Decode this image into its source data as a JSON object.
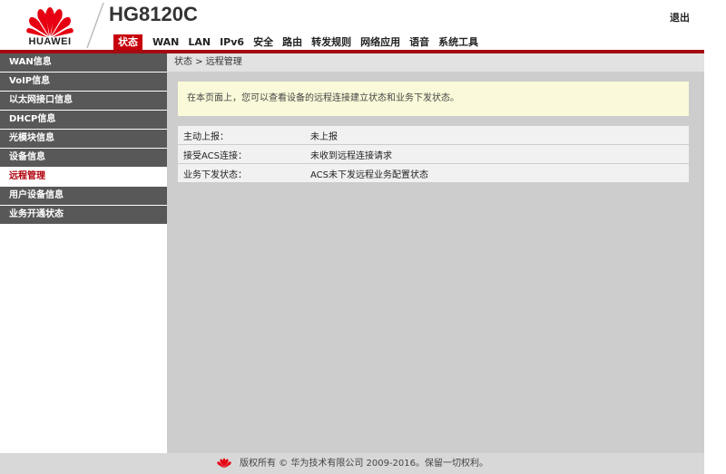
{
  "header": {
    "brand": "HUAWEI",
    "model": "HG8120C",
    "logout": "退出"
  },
  "nav": [
    "状态",
    "WAN",
    "LAN",
    "IPv6",
    "安全",
    "路由",
    "转发规则",
    "网络应用",
    "语音",
    "系统工具"
  ],
  "nav_active": 0,
  "sidebar": [
    "WAN信息",
    "VoIP信息",
    "以太网接口信息",
    "DHCP信息",
    "光模块信息",
    "设备信息",
    "远程管理",
    "用户设备信息",
    "业务开通状态"
  ],
  "sidebar_active": 6,
  "breadcrumb": "状态 > 远程管理",
  "notice": "在本页面上，您可以查看设备的远程连接建立状态和业务下发状态。",
  "info_rows": [
    {
      "label": "主动上报：",
      "value": "未上报"
    },
    {
      "label": "接受ACS连接：",
      "value": "未收到远程连接请求"
    },
    {
      "label": "业务下发状态：",
      "value": "ACS未下发远程业务配置状态"
    }
  ],
  "footer": "版权所有 © 华为技术有限公司 2009-2016。保留一切权利。",
  "colors": {
    "accent": "#c7000b",
    "sidebar": "#585858",
    "main_bg": "#cdcdcd",
    "notice_bg": "#fafada"
  }
}
